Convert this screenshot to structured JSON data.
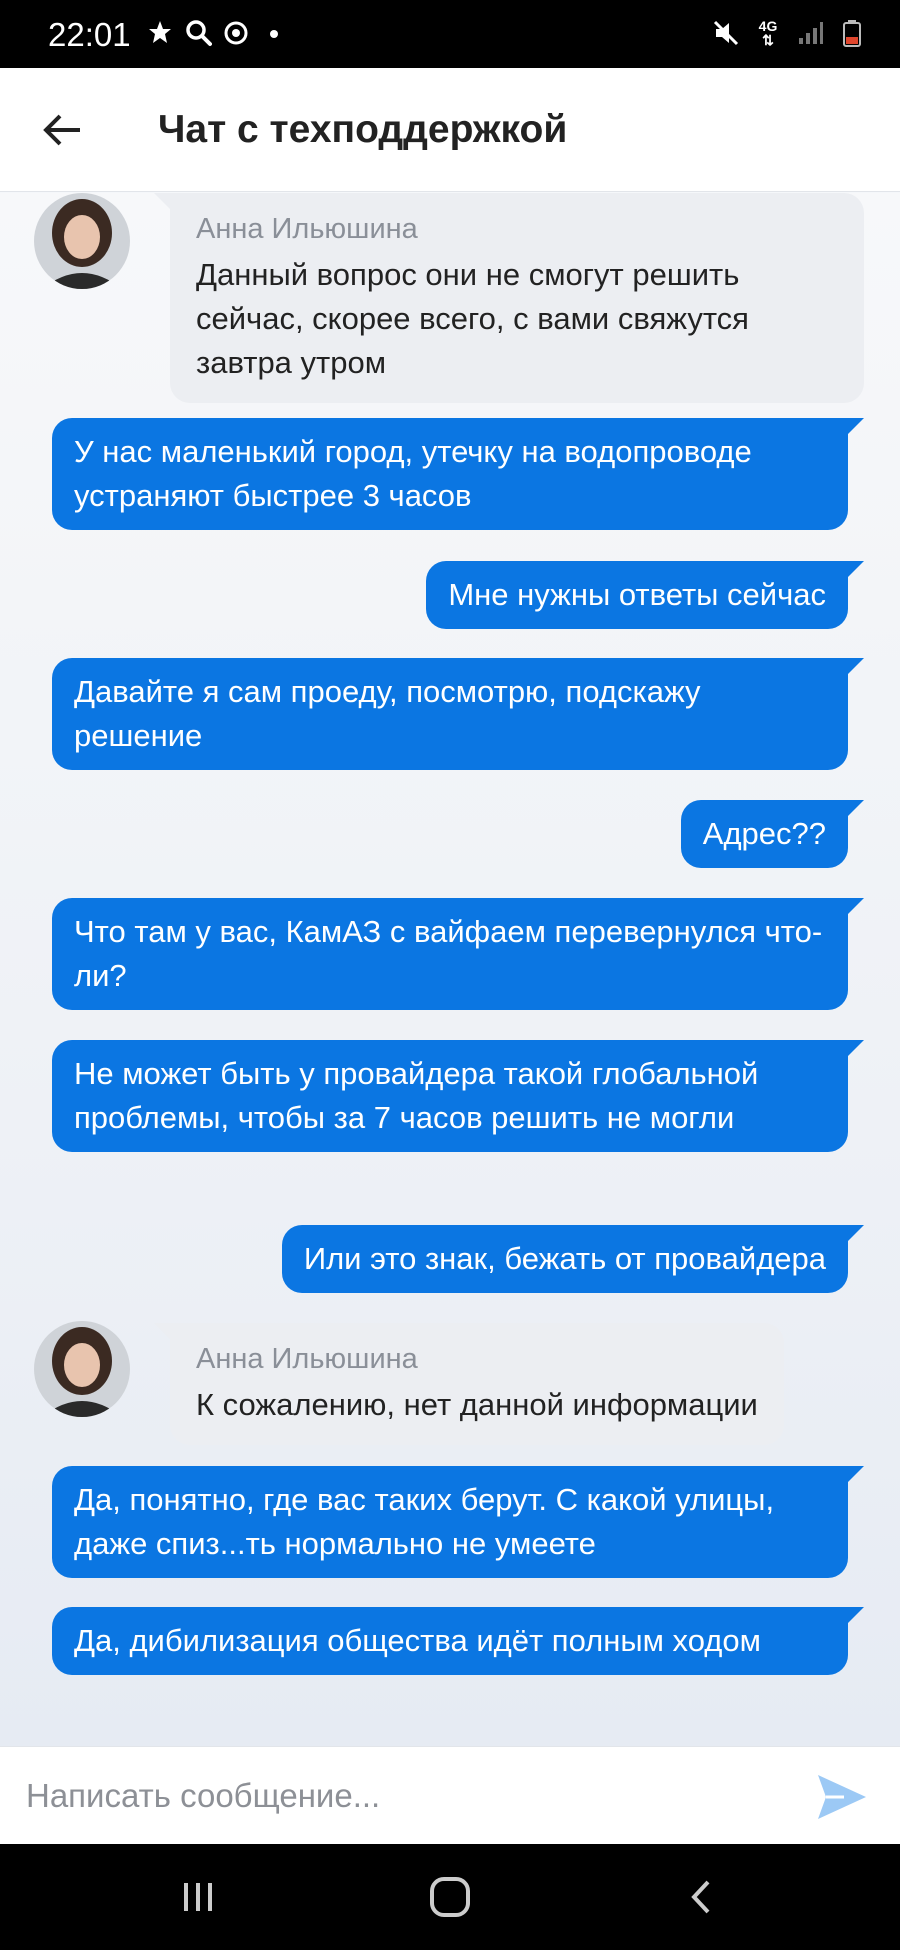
{
  "status_bar": {
    "time": "22:01",
    "left_icons": [
      "notification-icon",
      "search-icon",
      "sync-icon",
      "dot-icon"
    ],
    "right_icons": [
      "mute-icon",
      "network-4g-icon",
      "signal-icon",
      "battery-icon"
    ],
    "network_label": "4G"
  },
  "header": {
    "title": "Чат с техподдержкой",
    "back_icon": "arrow-left-icon"
  },
  "colors": {
    "outgoing_bubble": "#0b76e2",
    "incoming_bubble": "#eceef2",
    "send_icon": "#9cc9f5"
  },
  "messages": [
    {
      "direction": "incoming",
      "sender": "Анна Ильюшина",
      "text": "Данный вопрос они не смогут решить сейчас, скорее всего, с вами свяжутся завтра утром"
    },
    {
      "direction": "outgoing",
      "text": "У нас маленький город, утечку на водопроводе устраняют быстрее 3 часов"
    },
    {
      "direction": "outgoing",
      "text": "Мне нужны ответы сейчас"
    },
    {
      "direction": "outgoing",
      "text": "Давайте я сам проеду, посмотрю, подскажу решение"
    },
    {
      "direction": "outgoing",
      "text": "Адрес??"
    },
    {
      "direction": "outgoing",
      "text": "Что там у вас, КамАЗ с вайфаем перевернулся что-ли?"
    },
    {
      "direction": "outgoing",
      "text": "Не может быть у провайдера такой глобальной проблемы, чтобы за 7 часов решить не могли"
    },
    {
      "direction": "outgoing",
      "text": "Или это знак, бежать от провайдера"
    },
    {
      "direction": "incoming",
      "sender": "Анна Ильюшина",
      "text": "К сожалению, нет данной информации"
    },
    {
      "direction": "outgoing",
      "text": "Да, понятно, где вас таких берут. С какой улицы, даже спиз...ть нормально не умеете"
    },
    {
      "direction": "outgoing",
      "text": "Да, дибилизация общества идёт полным ходом"
    }
  ],
  "composer": {
    "placeholder": "Написать сообщение...",
    "send_icon": "send-icon"
  },
  "nav_bar": {
    "buttons": [
      "recent-apps-icon",
      "home-icon",
      "back-icon"
    ]
  }
}
